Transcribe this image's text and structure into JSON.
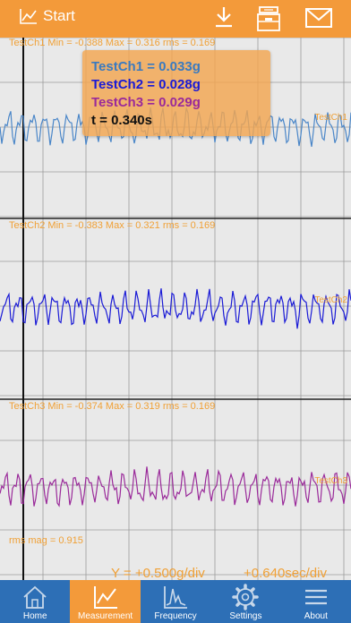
{
  "toolbar": {
    "start_label": "Start",
    "icons": [
      "chart-icon",
      "download-icon",
      "archive-icon",
      "mail-icon"
    ]
  },
  "channels": [
    {
      "info": "TestCh1 Min = -0.388 Max = 0.316 rms = 0.169",
      "tag": "TestCh1",
      "color": "#4a86c8"
    },
    {
      "info": "TestCh2 Min = -0.383 Max = 0.321 rms = 0.169",
      "tag": "TestCh2",
      "color": "#1a1ad6"
    },
    {
      "info": "TestCh3 Min = -0.374 Max = 0.319 rms = 0.169",
      "tag": "TestCh3",
      "color": "#9a2a9a"
    }
  ],
  "readout": {
    "ch1": "TestCh1 = 0.033g",
    "ch2": "TestCh2 = 0.028g",
    "ch3": "TestCh3 = 0.029g",
    "time": "t = 0.340s"
  },
  "footer": {
    "rms_mag": "rms mag = 0.915",
    "y_scale": "Y = +0.500g/div",
    "x_scale": "+0.640sec/div"
  },
  "tabs": [
    {
      "label": "Home",
      "icon": "home-icon",
      "active": false
    },
    {
      "label": "Measurement",
      "icon": "chart-icon",
      "active": true
    },
    {
      "label": "Frequency",
      "icon": "spectrum-icon",
      "active": false
    },
    {
      "label": "Settings",
      "icon": "gear-icon",
      "active": false
    },
    {
      "label": "About",
      "icon": "list-icon",
      "active": false
    }
  ],
  "colors": {
    "accent": "#f39a3a",
    "tabbar": "#2d6fb6",
    "info_text": "#f0a035"
  }
}
